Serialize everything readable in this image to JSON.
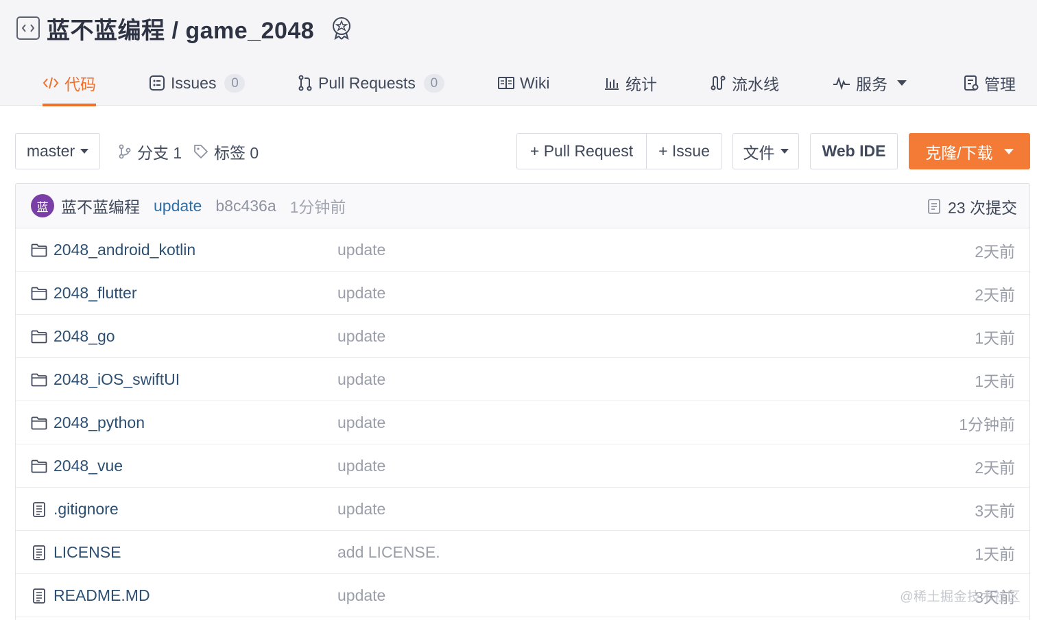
{
  "repo": {
    "title": "蓝不蓝编程 / game_2048"
  },
  "tabs": [
    {
      "label": "代码",
      "icon": "code-icon",
      "active": true
    },
    {
      "label": "Issues",
      "icon": "issues-icon",
      "count": "0"
    },
    {
      "label": "Pull Requests",
      "icon": "pull-request-icon",
      "count": "0"
    },
    {
      "label": "Wiki",
      "icon": "wiki-icon"
    },
    {
      "label": "统计",
      "icon": "stats-icon"
    },
    {
      "label": "流水线",
      "icon": "pipeline-icon"
    },
    {
      "label": "服务",
      "icon": "pulse-icon"
    },
    {
      "label": "管理",
      "icon": "manage-icon"
    }
  ],
  "toolbar": {
    "branch": "master",
    "branches": "分支 1",
    "tags": "标签 0",
    "new_pr": "+ Pull Request",
    "new_issue": "+ Issue",
    "file_menu": "文件",
    "web_ide": "Web IDE",
    "clone": "克隆/下载"
  },
  "commit": {
    "avatar_text": "蓝",
    "avatar_color": "#7a3fa6",
    "author": "蓝不蓝编程",
    "message": "update",
    "hash": "b8c436a",
    "time": "1分钟前",
    "commit_count": "23 次提交"
  },
  "files": [
    {
      "name": "2048_android_kotlin",
      "type": "folder",
      "message": "update",
      "time": "2天前"
    },
    {
      "name": "2048_flutter",
      "type": "folder",
      "message": "update",
      "time": "2天前"
    },
    {
      "name": "2048_go",
      "type": "folder",
      "message": "update",
      "time": "1天前"
    },
    {
      "name": "2048_iOS_swiftUI",
      "type": "folder",
      "message": "update",
      "time": "1天前"
    },
    {
      "name": "2048_python",
      "type": "folder",
      "message": "update",
      "time": "1分钟前"
    },
    {
      "name": "2048_vue",
      "type": "folder",
      "message": "update",
      "time": "2天前"
    },
    {
      "name": ".gitignore",
      "type": "file",
      "message": "update",
      "time": "3天前"
    },
    {
      "name": "LICENSE",
      "type": "file",
      "message": "add LICENSE.",
      "time": "1天前"
    },
    {
      "name": "README.MD",
      "type": "file",
      "message": "update",
      "time": "3天前"
    }
  ],
  "watermark": "@稀土掘金技术社区",
  "colors": {
    "accent": "#f0712c",
    "clone_button": "#f37b36",
    "link": "#2d4f72"
  }
}
